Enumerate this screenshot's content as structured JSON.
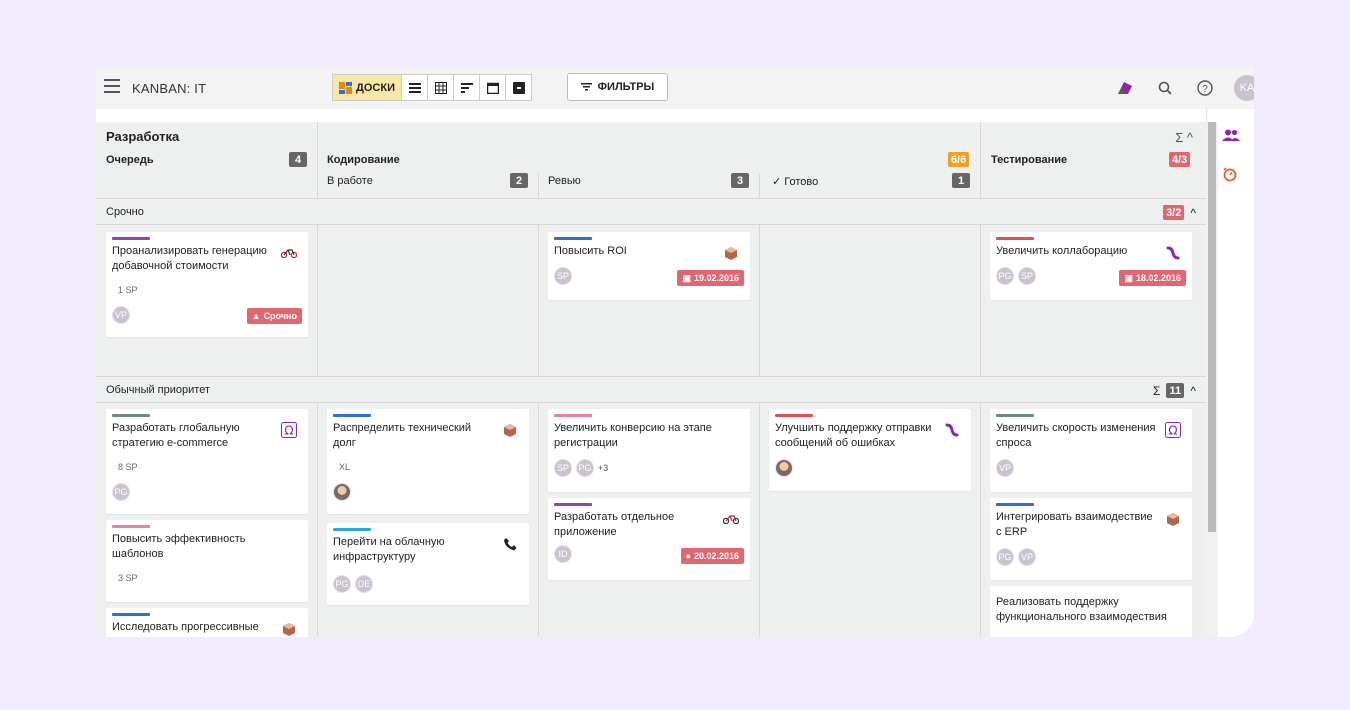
{
  "toolbar": {
    "title": "KANBAN: IT",
    "views_active": "ДОСКИ",
    "filters": "ФИЛЬТРЫ",
    "user_initials": "KA"
  },
  "board": {
    "section": "Разработка",
    "sigma": "Σ ^",
    "columns": {
      "queue": {
        "name": "Очередь",
        "count": "4"
      },
      "coding": {
        "name": "Кодирование",
        "count": "6/6"
      },
      "inwork": {
        "name": "В работе",
        "count": "2"
      },
      "review": {
        "name": "Ревью",
        "count": "3"
      },
      "done": {
        "name": "✓ Готово",
        "count": "1"
      },
      "testing": {
        "name": "Тестирование",
        "count": "4/3"
      }
    },
    "lanes": {
      "urgent": {
        "title": "Срочно",
        "count": "3/2",
        "chevron": "^"
      },
      "normal": {
        "title": "Обычный приоритет",
        "sigma": "Σ",
        "count": "11",
        "chevron": "^"
      }
    }
  },
  "cards": {
    "u1": {
      "title": "Проанализировать генерацию добавочной стоимости",
      "sp": "1 SP",
      "avatars": [
        "VP"
      ],
      "badge": "Срочно",
      "icon": "bicycle-icon",
      "color": "#8e44ad"
    },
    "u2": {
      "title": "Повысить ROI",
      "avatars": [
        "SP"
      ],
      "date": "19.02.2016",
      "icon": "box-icon",
      "color": "#2f6fcf"
    },
    "u3": {
      "title": "Увеличить коллаборацию",
      "avatars": [
        "PG",
        "SP"
      ],
      "date": "18.02.2016",
      "icon": "worm-icon",
      "color": "#e05050"
    },
    "n1": {
      "title": "Разработать глобальную стратегию e-commerce",
      "sp": "8 SP",
      "avatars": [
        "PG"
      ],
      "icon": "omega-icon",
      "color": "#6a8a8a"
    },
    "n2": {
      "title": "Повысить эффективность шаблонов",
      "sp": "3 SP",
      "color": "#e87fa6"
    },
    "n3": {
      "title": "Исследовать прогрессивные",
      "icon": "box-icon",
      "color": "#2f6fcf"
    },
    "n4": {
      "title": "Распределить технический долг",
      "sp": "XL",
      "icon": "box-icon",
      "color": "#2f6fcf"
    },
    "n5": {
      "title": "Перейти на облачную инфраструктуру",
      "avatars": [
        "PG",
        "DE"
      ],
      "icon": "phone-icon",
      "color": "#2aa9e0"
    },
    "n6": {
      "title": "Увеличить конверсию на этапе регистрации",
      "avatars": [
        "SP",
        "PG"
      ],
      "more": "+3",
      "color": "#e87fa6"
    },
    "n7": {
      "title": "Разработать отдельное приложение",
      "avatars": [
        "ID"
      ],
      "date": "20.02.2016",
      "icon": "bicycle-icon",
      "color": "#8e44ad"
    },
    "n8": {
      "title": "Улучшить поддержку отправки сообщений об ошибках",
      "icon": "worm-icon",
      "color": "#e05050"
    },
    "n9": {
      "title": "Увеличить скорость изменения спроса",
      "avatars": [
        "VP"
      ],
      "icon": "omega-icon",
      "color": "#6a8a8a"
    },
    "n10": {
      "title": "Интегрировать взаимодествие с ERP",
      "avatars": [
        "PG",
        "VP"
      ],
      "icon": "box-icon",
      "color": "#2f6fcf"
    },
    "n11": {
      "title": "Реализовать поддержку функционального взаимодествия"
    }
  }
}
